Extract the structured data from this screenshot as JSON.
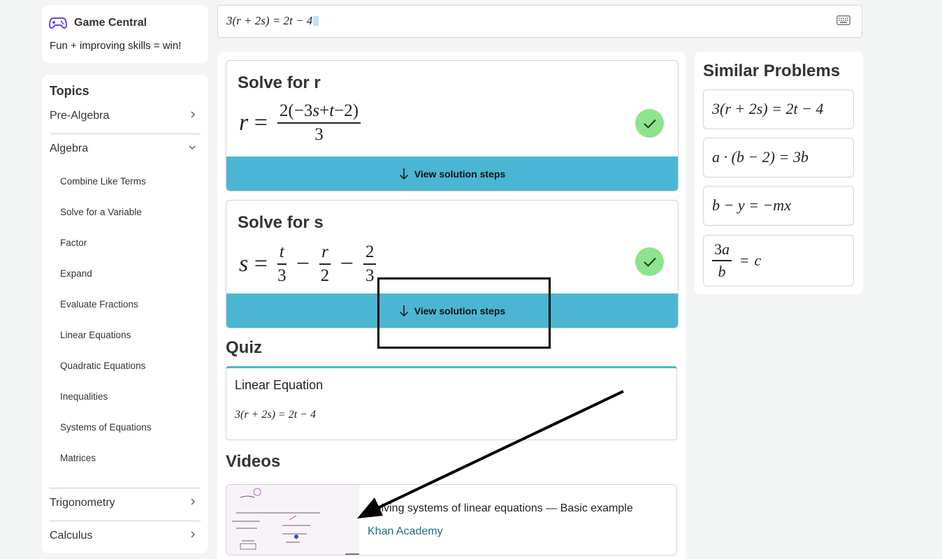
{
  "brand": {
    "name": "Game Central",
    "tagline": "Fun + improving skills = win!",
    "icon": "gamepad-icon",
    "accent": "#5b4bd6"
  },
  "search": {
    "value": "3(r + 2s) = 2t − 4",
    "keyboard_icon": "keyboard-icon"
  },
  "topics": {
    "heading": "Topics",
    "items": [
      {
        "label": "Pre-Algebra",
        "expanded": false
      },
      {
        "label": "Algebra",
        "expanded": true
      },
      {
        "label": "Trigonometry",
        "expanded": false
      },
      {
        "label": "Calculus",
        "expanded": false
      }
    ],
    "algebra_sub": [
      "Combine Like Terms",
      "Solve for a Variable",
      "Factor",
      "Expand",
      "Evaluate Fractions",
      "Linear Equations",
      "Quadratic Equations",
      "Inequalities",
      "Systems of Equations",
      "Matrices"
    ]
  },
  "solutions": [
    {
      "title": "Solve for r",
      "button": "View solution steps"
    },
    {
      "title": "Solve for s",
      "button": "View solution steps"
    }
  ],
  "quiz": {
    "heading": "Quiz",
    "card_title": "Linear Equation",
    "equation": "3(r + 2s) = 2t − 4"
  },
  "videos": {
    "heading": "Videos",
    "items": [
      {
        "title": "Solving systems of linear equations — Basic example",
        "source": "Khan Academy"
      }
    ]
  },
  "similar": {
    "heading": "Similar Problems",
    "items": [
      "3(r + 2s) = 2t − 4",
      "a · (b − 2) = 3b",
      "b − y = −mx"
    ]
  },
  "colors": {
    "button": "#4bb6d3",
    "check": "#8ee38e",
    "link": "#1f6e82",
    "background": "#f2f5f4"
  }
}
